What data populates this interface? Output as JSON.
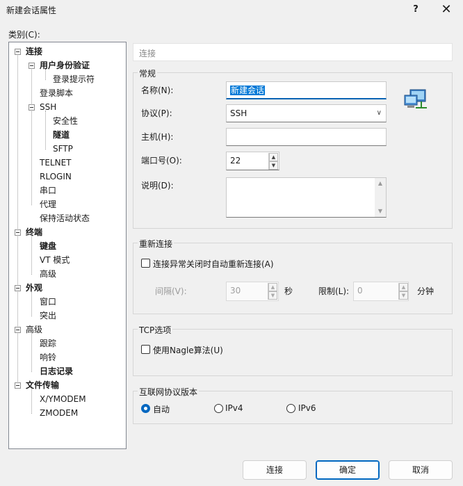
{
  "window": {
    "title": "新建会话属性",
    "help": "?",
    "close": "✕"
  },
  "category_label": "类别(C):",
  "tree": [
    {
      "label": "连接",
      "bold": true
    },
    {
      "label": "用户身份验证",
      "bold": true
    },
    {
      "label": "登录提示符",
      "bold": false
    },
    {
      "label": "登录脚本",
      "bold": false
    },
    {
      "label": "SSH",
      "bold": false
    },
    {
      "label": "安全性",
      "bold": false
    },
    {
      "label": "隧道",
      "bold": true
    },
    {
      "label": "SFTP",
      "bold": false
    },
    {
      "label": "TELNET",
      "bold": false
    },
    {
      "label": "RLOGIN",
      "bold": false
    },
    {
      "label": "串口",
      "bold": false
    },
    {
      "label": "代理",
      "bold": false
    },
    {
      "label": "保持活动状态",
      "bold": false
    },
    {
      "label": "终端",
      "bold": true
    },
    {
      "label": "键盘",
      "bold": true
    },
    {
      "label": "VT 模式",
      "bold": false
    },
    {
      "label": "高级",
      "bold": false
    },
    {
      "label": "外观",
      "bold": true
    },
    {
      "label": "窗口",
      "bold": false
    },
    {
      "label": "突出",
      "bold": false
    },
    {
      "label": "高级",
      "bold": false
    },
    {
      "label": "跟踪",
      "bold": false
    },
    {
      "label": "响铃",
      "bold": false
    },
    {
      "label": "日志记录",
      "bold": true
    },
    {
      "label": "文件传输",
      "bold": true
    },
    {
      "label": "X/YMODEM",
      "bold": false
    },
    {
      "label": "ZMODEM",
      "bold": false
    }
  ],
  "header": "连接",
  "general": {
    "title": "常规",
    "name_label": "名称(N):",
    "name_value": "新建会话",
    "protocol_label": "协议(P):",
    "protocol_value": "SSH",
    "host_label": "主机(H):",
    "host_value": "",
    "port_label": "端口号(O):",
    "port_value": "22",
    "desc_label": "说明(D):",
    "desc_value": ""
  },
  "reconnect": {
    "title": "重新连接",
    "checkbox_label": "连接异常关闭时自动重新连接(A)",
    "interval_label": "间隔(V):",
    "interval_value": "30",
    "interval_unit": "秒",
    "limit_label": "限制(L):",
    "limit_value": "0",
    "limit_unit": "分钟"
  },
  "tcp": {
    "title": "TCP选项",
    "nagle_label": "使用Nagle算法(U)"
  },
  "ip": {
    "title": "互联网协议版本",
    "options": [
      "自动",
      "IPv4",
      "IPv6"
    ]
  },
  "buttons": {
    "connect": "连接",
    "ok": "确定",
    "cancel": "取消"
  }
}
